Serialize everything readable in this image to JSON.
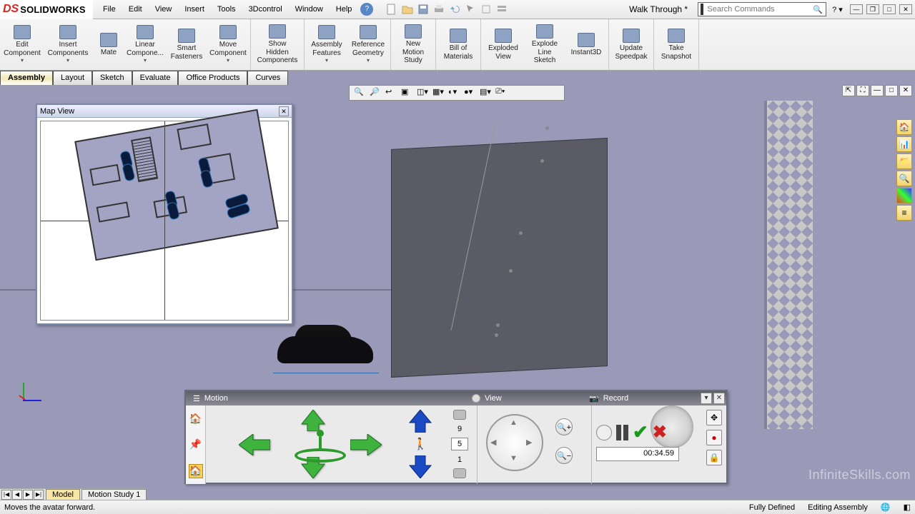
{
  "app": {
    "logo_prefix": "DS",
    "logo_text": "SOLIDWORKS"
  },
  "menu": {
    "items": [
      "File",
      "Edit",
      "View",
      "Insert",
      "Tools",
      "3Dcontrol",
      "Window",
      "Help"
    ]
  },
  "doc_name": "Walk Through *",
  "search": {
    "placeholder": "Search Commands"
  },
  "ribbon": [
    {
      "id": "edit-component",
      "label": "Edit\nComponent"
    },
    {
      "id": "insert-components",
      "label": "Insert\nComponents"
    },
    {
      "id": "mate",
      "label": "Mate"
    },
    {
      "id": "linear-compone",
      "label": "Linear\nCompone..."
    },
    {
      "id": "smart-fasteners",
      "label": "Smart\nFasteners"
    },
    {
      "id": "move-component",
      "label": "Move\nComponent"
    },
    {
      "id": "show-hidden",
      "label": "Show\nHidden\nComponents"
    },
    {
      "id": "assembly-features",
      "label": "Assembly\nFeatures"
    },
    {
      "id": "reference-geometry",
      "label": "Reference\nGeometry"
    },
    {
      "id": "new-motion-study",
      "label": "New\nMotion\nStudy"
    },
    {
      "id": "bill-of-materials",
      "label": "Bill of\nMaterials"
    },
    {
      "id": "exploded-view",
      "label": "Exploded\nView"
    },
    {
      "id": "explode-line-sketch",
      "label": "Explode\nLine\nSketch"
    },
    {
      "id": "instant3d",
      "label": "Instant3D"
    },
    {
      "id": "update-speedpak",
      "label": "Update\nSpeedpak"
    },
    {
      "id": "take-snapshot",
      "label": "Take\nSnapshot"
    }
  ],
  "doc_tabs": [
    "Assembly",
    "Layout",
    "Sketch",
    "Evaluate",
    "Office Products",
    "Curves"
  ],
  "mapview": {
    "title": "Map View"
  },
  "mvr": {
    "motion_label": "Motion",
    "view_label": "View",
    "record_label": "Record",
    "speed_max": "9",
    "speed_cur": "5",
    "speed_min": "1",
    "time": "00:34.59"
  },
  "lower_tabs": [
    "Model",
    "Motion Study 1"
  ],
  "status": {
    "hint": "Moves the avatar forward.",
    "defined": "Fully Defined",
    "mode": "Editing Assembly"
  },
  "watermark": "InfiniteSkills.com"
}
